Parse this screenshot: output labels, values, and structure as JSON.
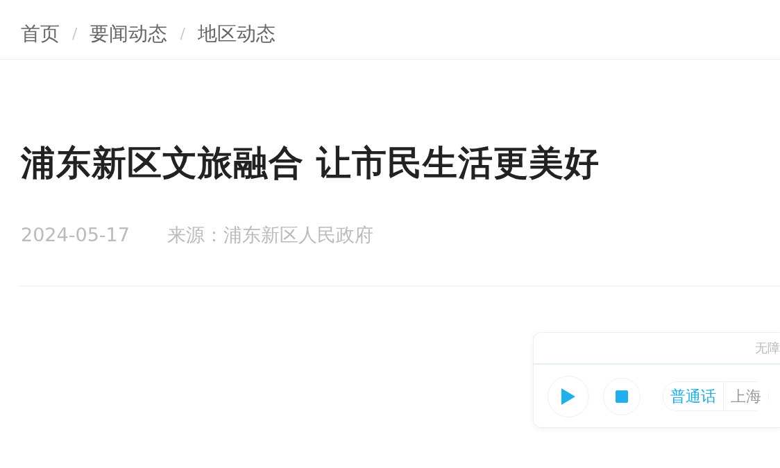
{
  "breadcrumb": [
    {
      "label": "首页"
    },
    {
      "label": "要闻动态"
    },
    {
      "label": "地区动态"
    }
  ],
  "breadcrumb_separator": "/",
  "article": {
    "title": "浦东新区文旅融合 让市民生活更美好",
    "date": "2024-05-17",
    "source": "来源：浦东新区人民政府"
  },
  "audio_player": {
    "header": "无障",
    "languages": [
      {
        "label": "普通话",
        "selected": true
      },
      {
        "label": "上海",
        "selected": false
      }
    ]
  }
}
